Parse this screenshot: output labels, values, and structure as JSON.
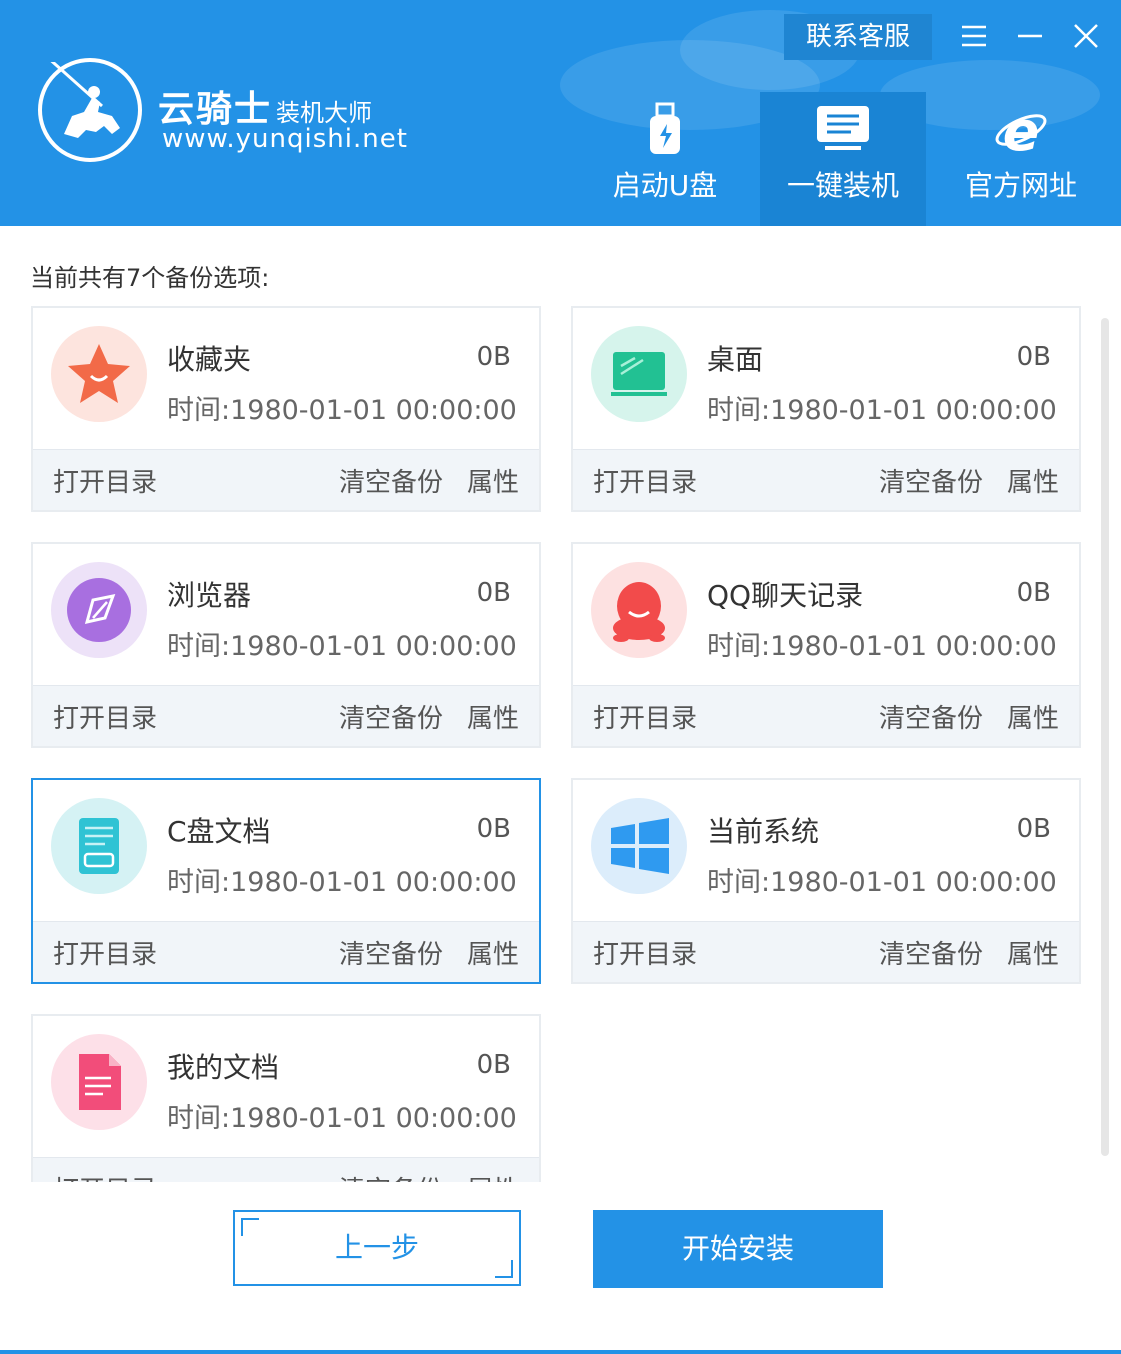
{
  "header": {
    "logo_main": "云骑士",
    "logo_sub": "装机大师",
    "logo_url": "www.yunqishi.net",
    "contact_label": "联系客服",
    "nav": [
      {
        "label": "启动U盘",
        "icon": "usb-drive-icon",
        "active": false
      },
      {
        "label": "一键装机",
        "icon": "monitor-icon",
        "active": true
      },
      {
        "label": "官方网址",
        "icon": "ie-browser-icon",
        "active": false
      }
    ]
  },
  "count_text": "当前共有7个备份选项:",
  "cards": [
    {
      "title": "收藏夹",
      "size": "0B",
      "time": "时间:1980-01-01 00:00:00",
      "icon": "star-icon",
      "open": "打开目录",
      "clear": "清空备份",
      "prop": "属性"
    },
    {
      "title": "桌面",
      "size": "0B",
      "time": "时间:1980-01-01 00:00:00",
      "icon": "desktop-icon",
      "open": "打开目录",
      "clear": "清空备份",
      "prop": "属性"
    },
    {
      "title": "浏览器",
      "size": "0B",
      "time": "时间:1980-01-01 00:00:00",
      "icon": "compass-icon",
      "open": "打开目录",
      "clear": "清空备份",
      "prop": "属性"
    },
    {
      "title": "QQ聊天记录",
      "size": "0B",
      "time": "时间:1980-01-01 00:00:00",
      "icon": "qq-penguin-icon",
      "open": "打开目录",
      "clear": "清空备份",
      "prop": "属性"
    },
    {
      "title": "C盘文档",
      "size": "0B",
      "time": "时间:1980-01-01 00:00:00",
      "icon": "drive-document-icon",
      "open": "打开目录",
      "clear": "清空备份",
      "prop": "属性"
    },
    {
      "title": "当前系统",
      "size": "0B",
      "time": "时间:1980-01-01 00:00:00",
      "icon": "windows-logo-icon",
      "open": "打开目录",
      "clear": "清空备份",
      "prop": "属性"
    },
    {
      "title": "我的文档",
      "size": "0B",
      "time": "时间:1980-01-01 00:00:00",
      "icon": "document-icon",
      "open": "打开目录",
      "clear": "清空备份",
      "prop": "属性"
    }
  ],
  "buttons": {
    "prev": "上一步",
    "start": "开始安装"
  },
  "colors": {
    "primary": "#2392e6",
    "nav_active": "#1a84d4",
    "card_border": "#e8ecf0",
    "footer_bg": "#f1f5f9"
  }
}
